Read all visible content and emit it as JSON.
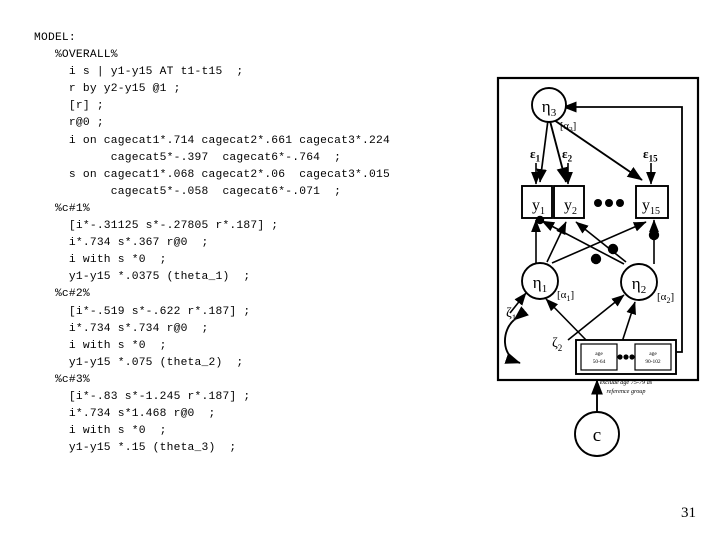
{
  "slide": {
    "page_number": "31"
  },
  "code": {
    "lines": [
      "MODEL:",
      "   %OVERALL%",
      "     i s | y1-y15 AT t1-t15  ;",
      "     r by y2-y15 @1 ;",
      "     [r] ;",
      "     r@0 ;",
      "     i on cagecat1*.714 cagecat2*.661 cagecat3*.224",
      "           cagecat5*-.397  cagecat6*-.764  ;",
      "     s on cagecat1*.068 cagecat2*.06  cagecat3*.015",
      "           cagecat5*-.058  cagecat6*-.071  ;",
      "   %c#1%",
      "     [i*-.31125 s*-.27805 r*.187] ;",
      "     i*.734 s*.367 r@0  ;",
      "     i with s *0  ;",
      "     y1-y15 *.0375 (theta_1)  ;",
      "   %c#2%",
      "     [i*-.519 s*-.622 r*.187] ;",
      "     i*.734 s*.734 r@0  ;",
      "     i with s *0  ;",
      "     y1-y15 *.075 (theta_2)  ;",
      "   %c#3%",
      "     [i*-.83 s*-1.245 r*.187] ;",
      "     i*.734 s*1.468 r@0  ;",
      "     i with s *0  ;",
      "     y1-y15 *.15 (theta_3)  ;"
    ]
  },
  "diagram": {
    "nodes": {
      "eta3": "η",
      "eta3_sub": "3",
      "eta3_mean": "[α",
      "eta3_mean_sub": "3",
      "eta3_mean_end": "]",
      "eta1": "η",
      "eta1_sub": "1",
      "eta1_mean": "[α",
      "eta1_mean_sub": "1",
      "eta1_mean_end": "]",
      "eta2": "η",
      "eta2_sub": "2",
      "eta2_mean": "[α",
      "eta2_mean_sub": "2",
      "eta2_mean_end": "]",
      "y1": "y",
      "y1_sub": "1",
      "y2": "y",
      "y2_sub": "2",
      "y15": "y",
      "y15_sub": "15",
      "eps1": "ε",
      "eps1_sub": "1",
      "eps2": "ε",
      "eps2_sub": "2",
      "eps15": "ε",
      "eps15_sub": "15",
      "zeta1": "ζ",
      "zeta1_sub": "1",
      "zeta2": "ζ",
      "zeta2_sub": "2",
      "class_node": "c"
    },
    "age_boxes": {
      "first_line1": "age",
      "first_line2": "50-64",
      "last_line1": "age",
      "last_line2": "90-102",
      "caption_line1": "exclude age  75-79  as",
      "caption_line2": "reference group"
    }
  }
}
